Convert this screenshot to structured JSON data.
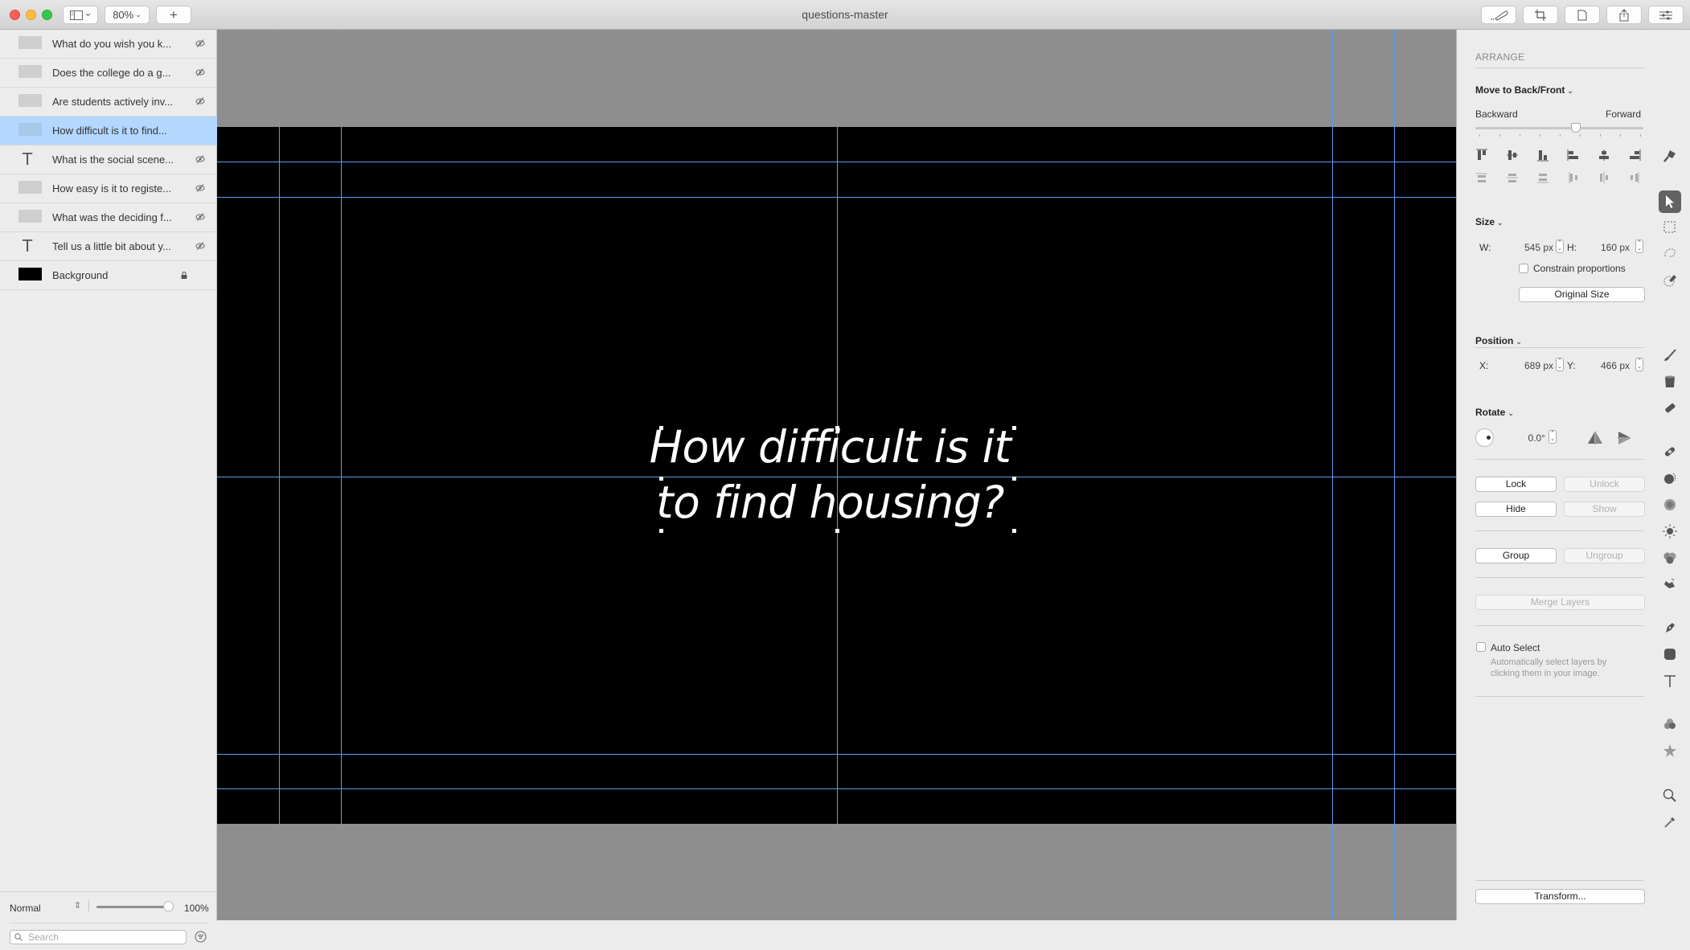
{
  "window": {
    "title": "questions-master",
    "zoom_level": "80%",
    "add_label": "+"
  },
  "layers": [
    {
      "name": "What do you wish you k...",
      "type": "image",
      "hidden": true
    },
    {
      "name": "Does the college do a g...",
      "type": "image",
      "hidden": true
    },
    {
      "name": "Are students actively inv...",
      "type": "image",
      "hidden": true
    },
    {
      "name": "How difficult is it to find...",
      "type": "image",
      "hidden": false,
      "selected": true
    },
    {
      "name": "What is the social scene...",
      "type": "text",
      "hidden": true
    },
    {
      "name": "How easy is it to registe...",
      "type": "image",
      "hidden": true
    },
    {
      "name": "What was the deciding f...",
      "type": "image",
      "hidden": true
    },
    {
      "name": "Tell us a little bit about y...",
      "type": "text",
      "hidden": true
    },
    {
      "name": "Background",
      "type": "fill",
      "locked": true
    }
  ],
  "sidebar_footer": {
    "blend_mode": "Normal",
    "opacity": "100%",
    "opacity_fraction": 1.0,
    "search_placeholder": "Search"
  },
  "canvas": {
    "text_line1": "How difficult is it",
    "text_line2": "to find housing?",
    "background_color": "#000000",
    "text_color": "#ffffff",
    "guide_color": "#5a9cf0"
  },
  "inspector": {
    "section_title": "ARRANGE",
    "move_title": "Move to Back/Front",
    "backward_label": "Backward",
    "forward_label": "Forward",
    "arrange_position": 0.6,
    "size_title": "Size",
    "w_label": "W:",
    "w_value": "545 px",
    "h_label": "H:",
    "h_value": "160 px",
    "constrain_label": "Constrain proportions",
    "original_size_label": "Original Size",
    "position_title": "Position",
    "x_label": "X:",
    "x_value": "689 px",
    "y_label": "Y:",
    "y_value": "466 px",
    "rotate_title": "Rotate",
    "rotate_value": "0.0°",
    "lock_label": "Lock",
    "unlock_label": "Unlock",
    "hide_label": "Hide",
    "show_label": "Show",
    "group_label": "Group",
    "ungroup_label": "Ungroup",
    "merge_label": "Merge Layers",
    "auto_select_label": "Auto Select",
    "auto_select_desc1": "Automatically select layers by",
    "auto_select_desc2": "clicking them in your image.",
    "transform_label": "Transform..."
  },
  "tools": [
    "paint-format",
    "arrow-select",
    "rect-select",
    "lasso-select",
    "quick-select",
    "brush",
    "bucket-fill",
    "eraser",
    "heal-bandage",
    "clone",
    "blur",
    "light",
    "color-adjust",
    "smudge",
    "pen",
    "shape",
    "text",
    "color-blend",
    "style-star",
    "zoom",
    "eyedropper"
  ]
}
